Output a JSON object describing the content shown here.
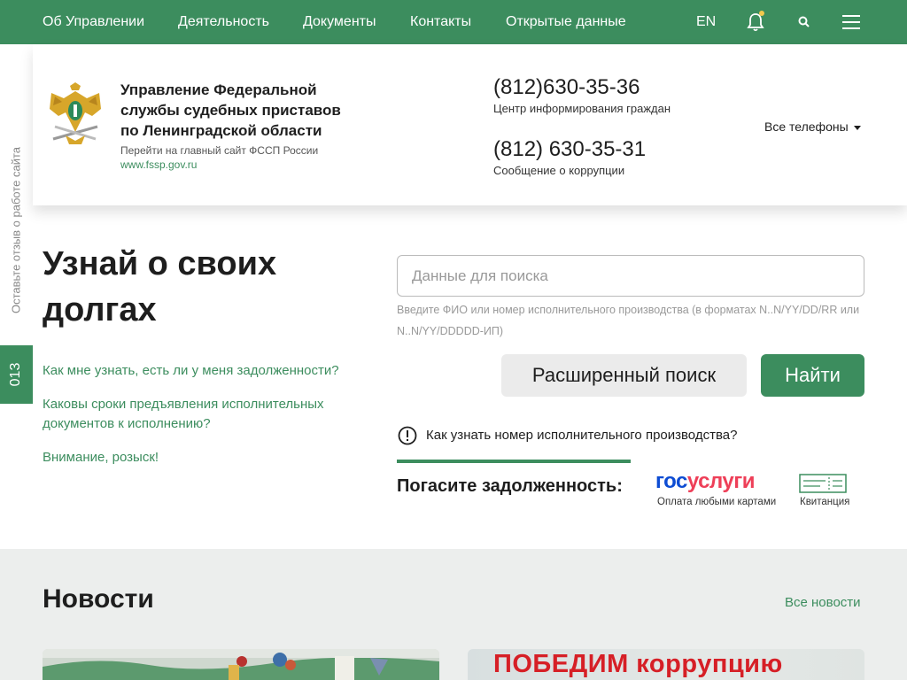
{
  "nav": {
    "items": [
      "Об Управлении",
      "Деятельность",
      "Документы",
      "Контакты",
      "Открытые данные"
    ],
    "lang": "EN"
  },
  "header": {
    "org_name": "Управление Федеральной службы судебных приставов по Ленинградской области",
    "main_site_text": "Перейти на главный сайт ФССП России",
    "main_site_link": "www.fssp.gov.ru",
    "phones": [
      {
        "number": "(812)630-35-36",
        "label": "Центр информирования граждан"
      },
      {
        "number": "(812) 630-35-31",
        "label": "Сообщение о коррупции"
      }
    ],
    "all_phones": "Все телефоны"
  },
  "side": {
    "feedback": "Оставьте отзыв о работе сайта",
    "badge": "013"
  },
  "debts": {
    "title": "Узнай о своих долгах",
    "faq": [
      "Как мне узнать, есть ли у меня задолженности?",
      "Каковы сроки предъявления исполнительных документов к исполнению?",
      "Внимание, розыск!"
    ],
    "search_placeholder": "Данные для поиска",
    "search_hint": "Введите ФИО или номер исполнительного производства (в форматах N..N/YY/DD/RR или N..N/YY/DDDDD-ИП)",
    "advanced_label": "Расширенный поиск",
    "find_label": "Найти",
    "how_to_link": "Как узнать номер исполнительного производства?",
    "pay_label": "Погасите задолженность:",
    "gosuslugi_part1": "гос",
    "gosuslugi_part2": "услуги",
    "gosuslugi_caption": "Оплата любыми картами",
    "receipt_caption": "Квитанция"
  },
  "news": {
    "title": "Новости",
    "all_link": "Все новости",
    "banner_text": "ПОБЕДИМ коррупцию"
  },
  "colors": {
    "brand_green": "#3c8d5e",
    "gos_blue": "#0d4cd3",
    "gos_red": "#ee3f58"
  }
}
